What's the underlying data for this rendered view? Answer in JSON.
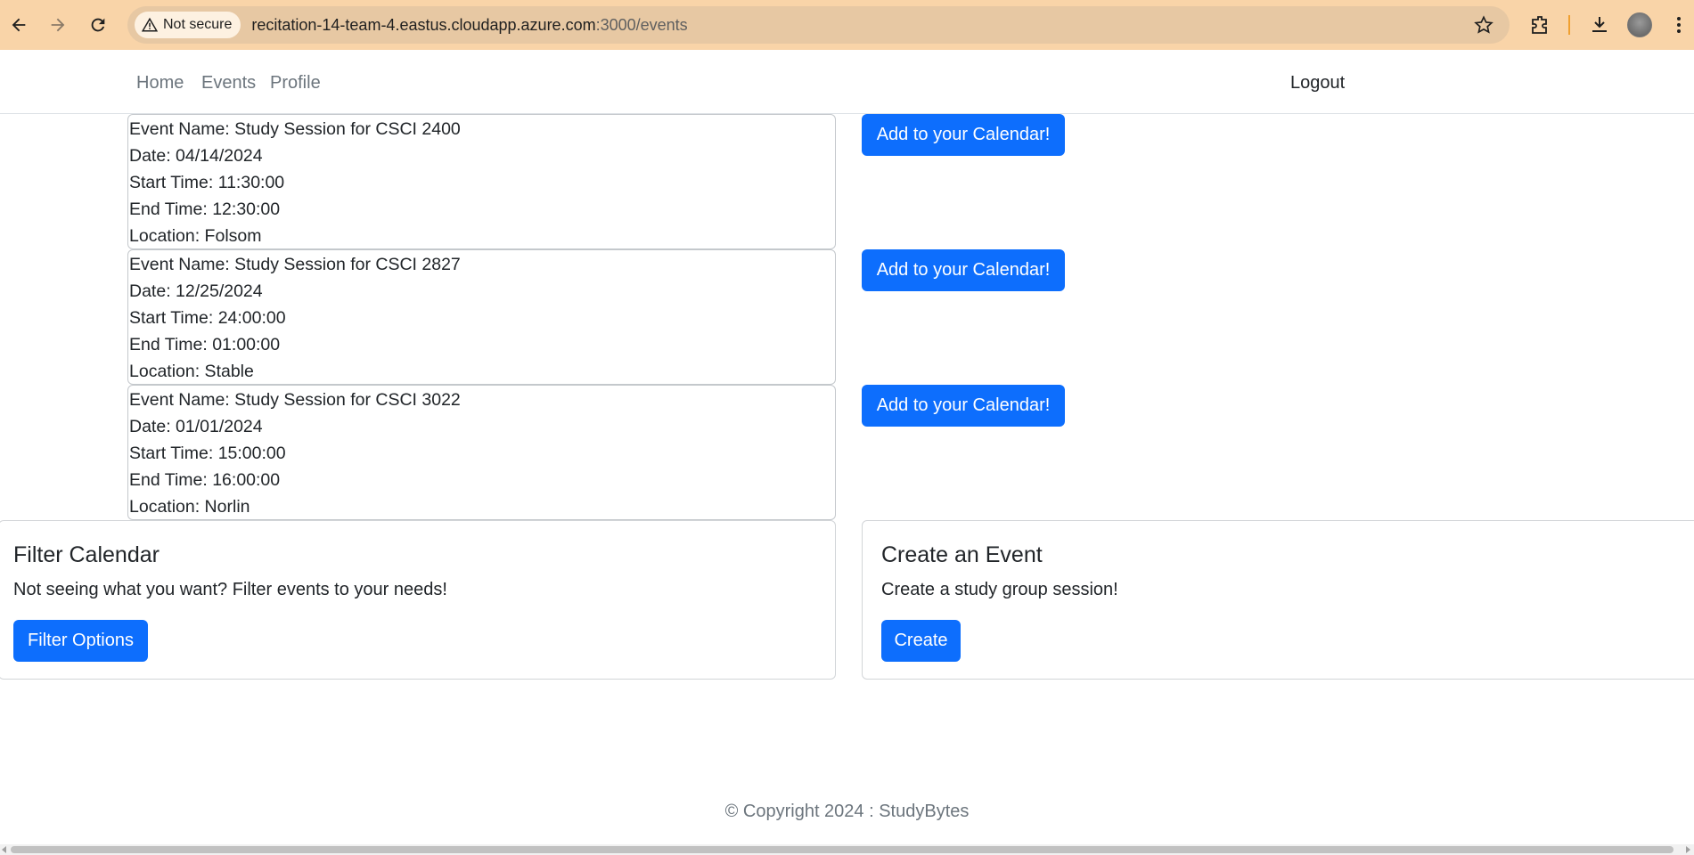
{
  "browser": {
    "security_label": "Not secure",
    "url_host": "recitation-14-team-4.eastus.cloudapp.azure.com",
    "url_rest": ":3000/events"
  },
  "navbar": {
    "links": [
      "Home",
      "Events",
      "Profile"
    ],
    "logout": "Logout"
  },
  "events": [
    {
      "name": "Event Name: Study Session for CSCI 2400",
      "date": "Date: 04/14/2024",
      "start": "Start Time: 11:30:00",
      "end": "End Time: 12:30:00",
      "location": "Location: Folsom",
      "button": "Add to your Calendar!"
    },
    {
      "name": "Event Name: Study Session for CSCI 2827",
      "date": "Date: 12/25/2024",
      "start": "Start Time: 24:00:00",
      "end": "End Time: 01:00:00",
      "location": "Location: Stable",
      "button": "Add to your Calendar!"
    },
    {
      "name": "Event Name: Study Session for CSCI 3022",
      "date": "Date: 01/01/2024",
      "start": "Start Time: 15:00:00",
      "end": "End Time: 16:00:00",
      "location": "Location: Norlin",
      "button": "Add to your Calendar!"
    }
  ],
  "filter_card": {
    "title": "Filter Calendar",
    "text": "Not seeing what you want? Filter events to your needs!",
    "button": "Filter Options"
  },
  "create_card": {
    "title": "Create an Event",
    "text": "Create a study group session!",
    "button": "Create"
  },
  "footer": "© Copyright 2024 : StudyBytes",
  "colors": {
    "primary": "#0d6efd",
    "chrome_bar": "#f9d4a8",
    "omnibox": "#e7c8a3"
  }
}
